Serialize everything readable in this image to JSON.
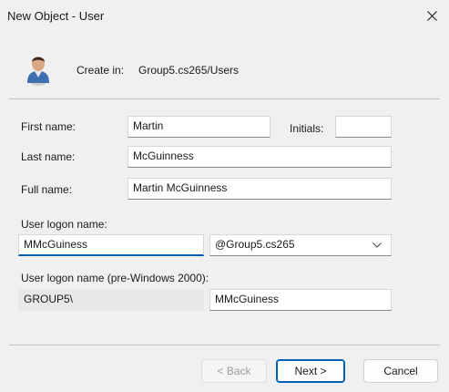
{
  "window": {
    "title": "New Object - User",
    "close_icon": "close-icon"
  },
  "header": {
    "icon": "user-icon",
    "create_in_label": "Create in:",
    "create_in_path": "Group5.cs265/Users"
  },
  "form": {
    "first_name": {
      "label": "First name:",
      "value": "Martin"
    },
    "initials": {
      "label": "Initials:",
      "value": ""
    },
    "last_name": {
      "label": "Last name:",
      "value": "McGuinness"
    },
    "full_name": {
      "label": "Full name:",
      "value": "Martin McGuinness"
    },
    "logon": {
      "label": "User logon name:",
      "value": "MMcGuiness",
      "domain": "@Group5.cs265"
    },
    "pre2000": {
      "label": "User logon name (pre-Windows 2000):",
      "prefix": "GROUP5\\",
      "value": "MMcGuiness"
    }
  },
  "buttons": {
    "back": "< Back",
    "next": "Next >",
    "cancel": "Cancel"
  },
  "colors": {
    "accent": "#005fb8",
    "background": "#f0f0f0"
  }
}
